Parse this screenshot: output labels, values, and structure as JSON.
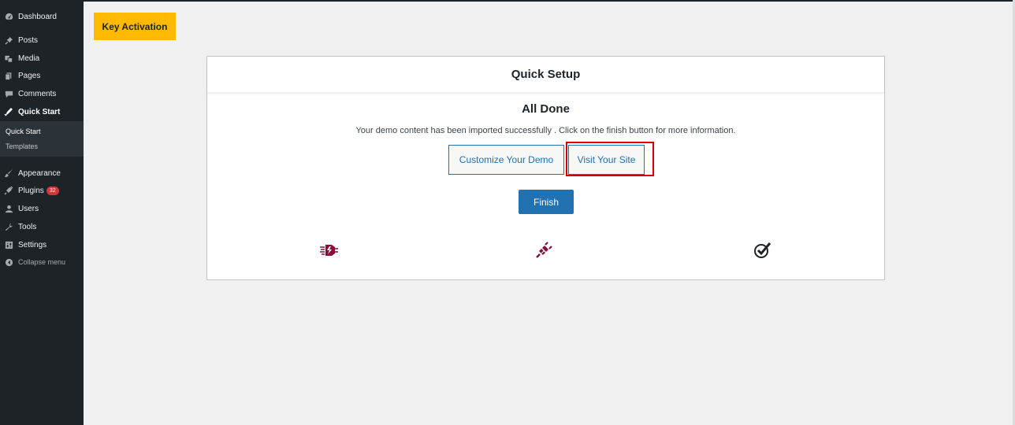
{
  "sidebar": {
    "items": [
      {
        "label": "Dashboard",
        "icon": "dashboard-icon"
      },
      {
        "label": "Posts",
        "icon": "pin-icon"
      },
      {
        "label": "Media",
        "icon": "media-icon"
      },
      {
        "label": "Pages",
        "icon": "pages-icon"
      },
      {
        "label": "Comments",
        "icon": "comments-icon"
      },
      {
        "label": "Quick Start",
        "icon": "quick-start-icon"
      },
      {
        "label": "Appearance",
        "icon": "brush-icon"
      },
      {
        "label": "Plugins",
        "icon": "plugin-icon",
        "badge": "32"
      },
      {
        "label": "Users",
        "icon": "user-icon"
      },
      {
        "label": "Tools",
        "icon": "wrench-icon"
      },
      {
        "label": "Settings",
        "icon": "settings-icon"
      },
      {
        "label": "Collapse menu",
        "icon": "collapse-icon"
      }
    ],
    "submenu": [
      {
        "label": "Quick Start"
      },
      {
        "label": "Templates"
      }
    ]
  },
  "key_activation": {
    "label": "Key Activation"
  },
  "panel": {
    "title": "Quick Setup",
    "done_title": "All Done",
    "done_desc": "Your demo content has been imported successfully . Click on the finish button for more information.",
    "customize_label": "Customize Your Demo",
    "visit_label": "Visit Your Site",
    "finish_label": "Finish",
    "steps": [
      {
        "icon": "plugin-install-icon"
      },
      {
        "icon": "plug-connect-icon"
      },
      {
        "icon": "checkmark-icon"
      }
    ]
  },
  "colors": {
    "sidebar_bg": "#1d2327",
    "accent": "#2271b1",
    "key_button": "#ffb900",
    "step_icon": "#8a0a3a",
    "highlight": "#d00000"
  }
}
